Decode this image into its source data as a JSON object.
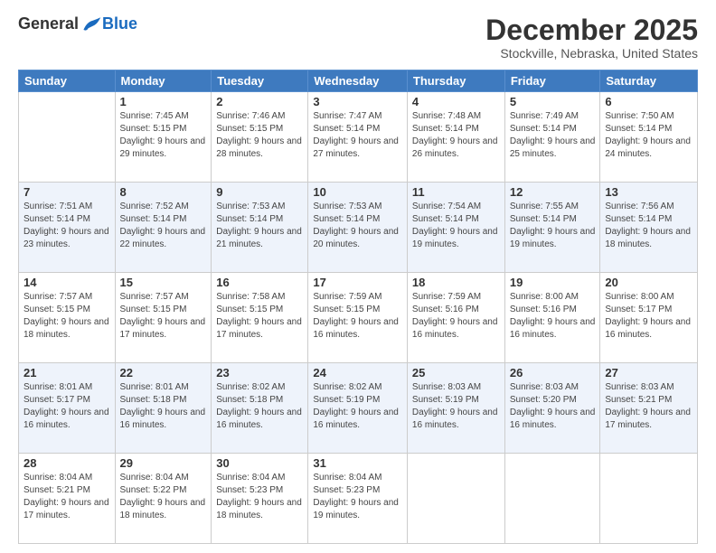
{
  "header": {
    "logo_general": "General",
    "logo_blue": "Blue",
    "month_title": "December 2025",
    "subtitle": "Stockville, Nebraska, United States"
  },
  "weekdays": [
    "Sunday",
    "Monday",
    "Tuesday",
    "Wednesday",
    "Thursday",
    "Friday",
    "Saturday"
  ],
  "weeks": [
    [
      {
        "day": "",
        "sunrise": "",
        "sunset": "",
        "daylight": ""
      },
      {
        "day": "1",
        "sunrise": "Sunrise: 7:45 AM",
        "sunset": "Sunset: 5:15 PM",
        "daylight": "Daylight: 9 hours and 29 minutes."
      },
      {
        "day": "2",
        "sunrise": "Sunrise: 7:46 AM",
        "sunset": "Sunset: 5:15 PM",
        "daylight": "Daylight: 9 hours and 28 minutes."
      },
      {
        "day": "3",
        "sunrise": "Sunrise: 7:47 AM",
        "sunset": "Sunset: 5:14 PM",
        "daylight": "Daylight: 9 hours and 27 minutes."
      },
      {
        "day": "4",
        "sunrise": "Sunrise: 7:48 AM",
        "sunset": "Sunset: 5:14 PM",
        "daylight": "Daylight: 9 hours and 26 minutes."
      },
      {
        "day": "5",
        "sunrise": "Sunrise: 7:49 AM",
        "sunset": "Sunset: 5:14 PM",
        "daylight": "Daylight: 9 hours and 25 minutes."
      },
      {
        "day": "6",
        "sunrise": "Sunrise: 7:50 AM",
        "sunset": "Sunset: 5:14 PM",
        "daylight": "Daylight: 9 hours and 24 minutes."
      }
    ],
    [
      {
        "day": "7",
        "sunrise": "Sunrise: 7:51 AM",
        "sunset": "Sunset: 5:14 PM",
        "daylight": "Daylight: 9 hours and 23 minutes."
      },
      {
        "day": "8",
        "sunrise": "Sunrise: 7:52 AM",
        "sunset": "Sunset: 5:14 PM",
        "daylight": "Daylight: 9 hours and 22 minutes."
      },
      {
        "day": "9",
        "sunrise": "Sunrise: 7:53 AM",
        "sunset": "Sunset: 5:14 PM",
        "daylight": "Daylight: 9 hours and 21 minutes."
      },
      {
        "day": "10",
        "sunrise": "Sunrise: 7:53 AM",
        "sunset": "Sunset: 5:14 PM",
        "daylight": "Daylight: 9 hours and 20 minutes."
      },
      {
        "day": "11",
        "sunrise": "Sunrise: 7:54 AM",
        "sunset": "Sunset: 5:14 PM",
        "daylight": "Daylight: 9 hours and 19 minutes."
      },
      {
        "day": "12",
        "sunrise": "Sunrise: 7:55 AM",
        "sunset": "Sunset: 5:14 PM",
        "daylight": "Daylight: 9 hours and 19 minutes."
      },
      {
        "day": "13",
        "sunrise": "Sunrise: 7:56 AM",
        "sunset": "Sunset: 5:14 PM",
        "daylight": "Daylight: 9 hours and 18 minutes."
      }
    ],
    [
      {
        "day": "14",
        "sunrise": "Sunrise: 7:57 AM",
        "sunset": "Sunset: 5:15 PM",
        "daylight": "Daylight: 9 hours and 18 minutes."
      },
      {
        "day": "15",
        "sunrise": "Sunrise: 7:57 AM",
        "sunset": "Sunset: 5:15 PM",
        "daylight": "Daylight: 9 hours and 17 minutes."
      },
      {
        "day": "16",
        "sunrise": "Sunrise: 7:58 AM",
        "sunset": "Sunset: 5:15 PM",
        "daylight": "Daylight: 9 hours and 17 minutes."
      },
      {
        "day": "17",
        "sunrise": "Sunrise: 7:59 AM",
        "sunset": "Sunset: 5:15 PM",
        "daylight": "Daylight: 9 hours and 16 minutes."
      },
      {
        "day": "18",
        "sunrise": "Sunrise: 7:59 AM",
        "sunset": "Sunset: 5:16 PM",
        "daylight": "Daylight: 9 hours and 16 minutes."
      },
      {
        "day": "19",
        "sunrise": "Sunrise: 8:00 AM",
        "sunset": "Sunset: 5:16 PM",
        "daylight": "Daylight: 9 hours and 16 minutes."
      },
      {
        "day": "20",
        "sunrise": "Sunrise: 8:00 AM",
        "sunset": "Sunset: 5:17 PM",
        "daylight": "Daylight: 9 hours and 16 minutes."
      }
    ],
    [
      {
        "day": "21",
        "sunrise": "Sunrise: 8:01 AM",
        "sunset": "Sunset: 5:17 PM",
        "daylight": "Daylight: 9 hours and 16 minutes."
      },
      {
        "day": "22",
        "sunrise": "Sunrise: 8:01 AM",
        "sunset": "Sunset: 5:18 PM",
        "daylight": "Daylight: 9 hours and 16 minutes."
      },
      {
        "day": "23",
        "sunrise": "Sunrise: 8:02 AM",
        "sunset": "Sunset: 5:18 PM",
        "daylight": "Daylight: 9 hours and 16 minutes."
      },
      {
        "day": "24",
        "sunrise": "Sunrise: 8:02 AM",
        "sunset": "Sunset: 5:19 PM",
        "daylight": "Daylight: 9 hours and 16 minutes."
      },
      {
        "day": "25",
        "sunrise": "Sunrise: 8:03 AM",
        "sunset": "Sunset: 5:19 PM",
        "daylight": "Daylight: 9 hours and 16 minutes."
      },
      {
        "day": "26",
        "sunrise": "Sunrise: 8:03 AM",
        "sunset": "Sunset: 5:20 PM",
        "daylight": "Daylight: 9 hours and 16 minutes."
      },
      {
        "day": "27",
        "sunrise": "Sunrise: 8:03 AM",
        "sunset": "Sunset: 5:21 PM",
        "daylight": "Daylight: 9 hours and 17 minutes."
      }
    ],
    [
      {
        "day": "28",
        "sunrise": "Sunrise: 8:04 AM",
        "sunset": "Sunset: 5:21 PM",
        "daylight": "Daylight: 9 hours and 17 minutes."
      },
      {
        "day": "29",
        "sunrise": "Sunrise: 8:04 AM",
        "sunset": "Sunset: 5:22 PM",
        "daylight": "Daylight: 9 hours and 18 minutes."
      },
      {
        "day": "30",
        "sunrise": "Sunrise: 8:04 AM",
        "sunset": "Sunset: 5:23 PM",
        "daylight": "Daylight: 9 hours and 18 minutes."
      },
      {
        "day": "31",
        "sunrise": "Sunrise: 8:04 AM",
        "sunset": "Sunset: 5:23 PM",
        "daylight": "Daylight: 9 hours and 19 minutes."
      },
      {
        "day": "",
        "sunrise": "",
        "sunset": "",
        "daylight": ""
      },
      {
        "day": "",
        "sunrise": "",
        "sunset": "",
        "daylight": ""
      },
      {
        "day": "",
        "sunrise": "",
        "sunset": "",
        "daylight": ""
      }
    ]
  ]
}
